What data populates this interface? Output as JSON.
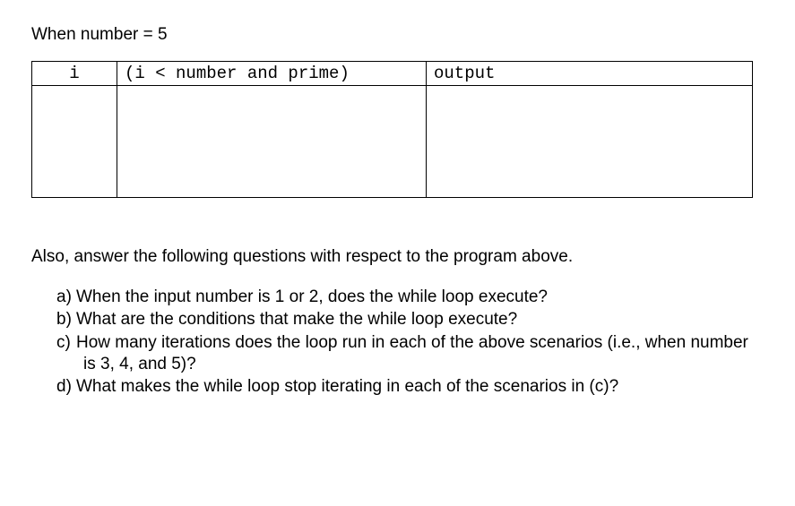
{
  "heading": "When number = 5",
  "table": {
    "headers": {
      "i": "i",
      "condition": "(i < number and prime)",
      "output": "output"
    }
  },
  "instruction": "Also, answer the following questions with respect to the program above.",
  "questions": {
    "a": {
      "marker": "a)",
      "text": "When the input number is 1 or 2, does the while loop execute?"
    },
    "b": {
      "marker": "b)",
      "text": "What are the conditions that make the while loop execute?"
    },
    "c": {
      "marker": "c)",
      "text": "How many iterations does the loop run in each of the above scenarios (i.e., when number is 3, 4, and 5)?"
    },
    "d": {
      "marker": "d)",
      "text": "What makes the while loop stop iterating in each of the scenarios in (c)?"
    }
  }
}
